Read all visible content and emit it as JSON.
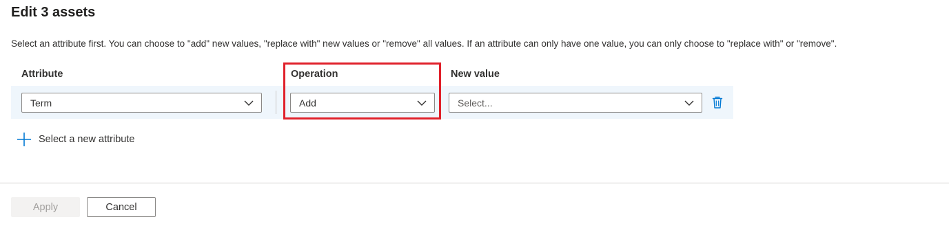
{
  "header": {
    "title": "Edit 3 assets"
  },
  "description": "Select an attribute first. You can choose to \"add\" new values, \"replace with\" new values or \"remove\" all values. If an attribute can only have one value, you can only choose to \"replace with\" or \"remove\".",
  "columns": {
    "attribute": "Attribute",
    "operation": "Operation",
    "new_value": "New value"
  },
  "row": {
    "attribute_value": "Term",
    "operation_value": "Add",
    "new_value_placeholder": "Select..."
  },
  "add_attribute_label": "Select a new attribute",
  "footer": {
    "apply_label": "Apply",
    "cancel_label": "Cancel"
  },
  "icons": {
    "dropdown": "chevron-down-icon",
    "delete": "trash-icon",
    "add": "plus-icon"
  },
  "colors": {
    "accent": "#0078d4",
    "highlight": "#e0202a",
    "row_background": "#eff6fc"
  }
}
